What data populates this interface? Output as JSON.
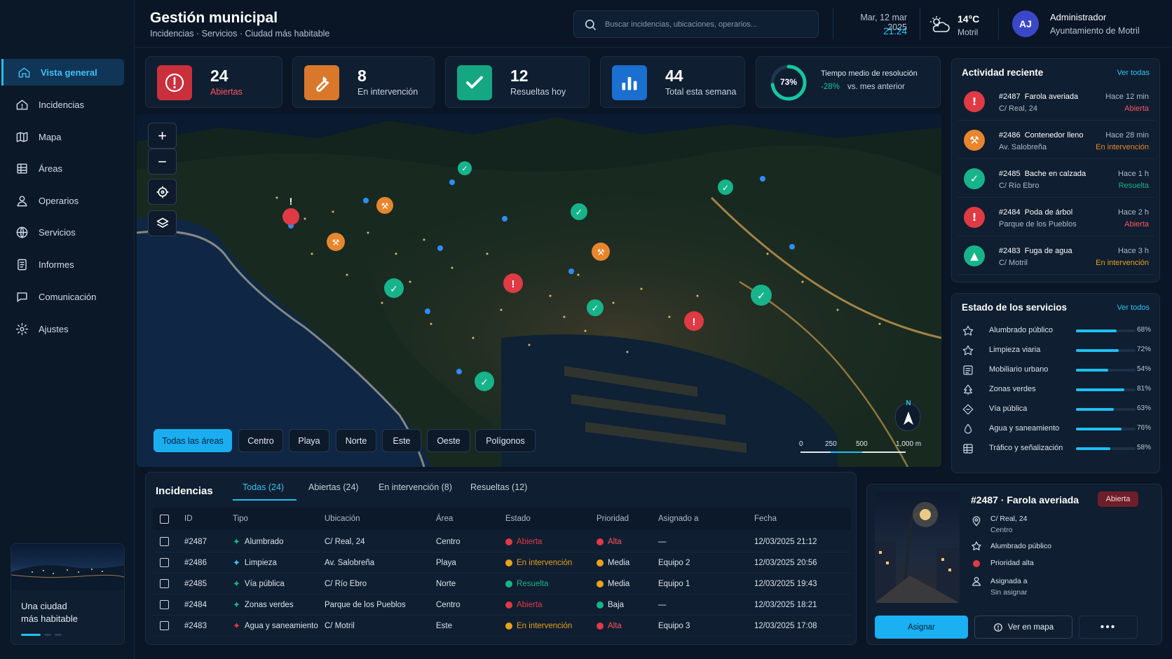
{
  "app": {
    "title": "Gestión municipal",
    "subtitle": "Incidencias · Servicios · Ciudad más habitable"
  },
  "search": {
    "placeholder": "Buscar incidencias, ubicaciones, operarios..."
  },
  "header": {
    "date": "Mar, 12 mar 2025",
    "time": "21:24",
    "temperature": "14°C",
    "location": "Motril"
  },
  "user": {
    "initials": "AJ",
    "name": "Administrador",
    "org": "Ayuntamiento de Motril"
  },
  "sidebar": {
    "items": [
      {
        "label": "Vista general",
        "icon": "home-icon",
        "active": true
      },
      {
        "label": "Incidencias",
        "icon": "alert-home-icon"
      },
      {
        "label": "Mapa",
        "icon": "map-icon"
      },
      {
        "label": "Áreas",
        "icon": "grid-icon"
      },
      {
        "label": "Operarios",
        "icon": "user-icon"
      },
      {
        "label": "Servicios",
        "icon": "globe-icon"
      },
      {
        "label": "Informes",
        "icon": "report-icon"
      },
      {
        "label": "Comunicación",
        "icon": "message-icon"
      },
      {
        "label": "Ajustes",
        "icon": "gear-icon"
      }
    ],
    "promo": {
      "line1": "Una ciudad",
      "line2": "más habitable"
    }
  },
  "stats": [
    {
      "value": "24",
      "label": "Abiertas",
      "color": "#e03a45",
      "icon": "alert-icon"
    },
    {
      "value": "8",
      "label": "En intervención",
      "color": "#e8862e",
      "icon": "wrench-icon"
    },
    {
      "value": "12",
      "label": "Resueltas hoy",
      "color": "#17b38a",
      "icon": "check-icon"
    },
    {
      "value": "44",
      "label": "Total esta semana",
      "color": "#1f8be8",
      "icon": "bar-chart-icon"
    }
  ],
  "resolution": {
    "percent": 73,
    "percent_label": "73%",
    "label": "Tiempo medio de resolución",
    "delta": "-28%",
    "delta_suffix": "vs. mes anterior"
  },
  "map": {
    "filters": [
      "Todas las áreas",
      "Centro",
      "Playa",
      "Norte",
      "Este",
      "Oeste",
      "Polígonos"
    ],
    "active_filter": "Todas las áreas",
    "compass": "N",
    "scale": [
      "0",
      "250",
      "500",
      "1,000 m"
    ]
  },
  "incidents": {
    "title": "Incidencias",
    "tabs": [
      "Todas (24)",
      "Abiertas (24)",
      "En intervención (8)",
      "Resueltas (12)"
    ],
    "columns": [
      "ID",
      "Tipo",
      "Ubicación",
      "Área",
      "Estado",
      "Prioridad",
      "Asignado a",
      "Fecha"
    ],
    "rows": [
      {
        "id": "#2487",
        "type": "Alumbrado",
        "type_color": "#17b38a",
        "location": "C/ Real, 24",
        "area": "Centro",
        "status": "Abierta",
        "status_color": "#e03a45",
        "priority": "Alta",
        "priority_color": "#e03a45",
        "assigned": "—",
        "date": "12/03/2025 21:12"
      },
      {
        "id": "#2486",
        "type": "Limpieza",
        "type_color": "#3ec3f5",
        "location": "Av. Salobreña",
        "area": "Playa",
        "status": "En intervención",
        "status_color": "#e8a21e",
        "priority": "Media",
        "priority_color": "#e8a21e",
        "assigned": "Equipo 2",
        "date": "12/03/2025 20:56"
      },
      {
        "id": "#2485",
        "type": "Vía pública",
        "type_color": "#17b38a",
        "location": "C/ Río Ebro",
        "area": "Norte",
        "status": "Resuelta",
        "status_color": "#17b38a",
        "priority": "Media",
        "priority_color": "#e8a21e",
        "assigned": "Equipo 1",
        "date": "12/03/2025 19:43"
      },
      {
        "id": "#2484",
        "type": "Zonas verdes",
        "type_color": "#17b38a",
        "location": "Parque de los Pueblos",
        "area": "Centro",
        "status": "Abierta",
        "status_color": "#e03a45",
        "priority": "Baja",
        "priority_color": "#17b38a",
        "assigned": "—",
        "date": "12/03/2025 18:21"
      },
      {
        "id": "#2483",
        "type": "Agua y saneamiento",
        "type_color": "#e03a45",
        "location": "C/ Motril",
        "area": "Este",
        "status": "En intervención",
        "status_color": "#e8a21e",
        "priority": "Alta",
        "priority_color": "#e03a45",
        "assigned": "Equipo 3",
        "date": "12/03/2025 17:08"
      }
    ]
  },
  "detail": {
    "title": "#2487 · Farola averiada",
    "badge": "Abierta",
    "address": "C/ Real, 24",
    "area": "Centro",
    "service": "Alumbrado público",
    "priority": "Prioridad alta",
    "assigned_label": "Asignada a",
    "assigned_value": "Sin asignar",
    "assign_button": "Asignar",
    "map_button": "Ver en mapa"
  },
  "activity": {
    "title": "Actividad reciente",
    "link": "Ver todas",
    "items": [
      {
        "id": "#2487",
        "title": "Farola averiada",
        "location": "C/ Real, 24",
        "time": "Hace 12 min",
        "status": "Abierta",
        "color": "#e03a45",
        "icon": "alert-icon"
      },
      {
        "id": "#2486",
        "title": "Contenedor lleno",
        "location": "Av. Salobreña",
        "time": "Hace 28 min",
        "status": "En intervención",
        "color": "#e8862e",
        "icon": "wrench-icon"
      },
      {
        "id": "#2485",
        "title": "Bache en calzada",
        "location": "C/ Río Ebro",
        "time": "Hace 1 h",
        "status": "Resuelta",
        "color": "#17b38a",
        "icon": "check-icon"
      },
      {
        "id": "#2484",
        "title": "Poda de árbol",
        "location": "Parque de los Pueblos",
        "time": "Hace 2 h",
        "status": "Abierta",
        "color": "#e03a45",
        "icon": "alert-icon"
      },
      {
        "id": "#2483",
        "title": "Fuga de agua",
        "location": "C/ Motril",
        "time": "Hace 3 h",
        "status": "En intervención",
        "color": "#17b38a",
        "status_color": "#e8a21e",
        "icon": "drop-icon"
      }
    ]
  },
  "services": {
    "title": "Estado de los servicios",
    "link": "Ver todos",
    "items": [
      {
        "name": "Alumbrado público",
        "percent": 68,
        "percent_label": "68%"
      },
      {
        "name": "Limpieza viaria",
        "percent": 72,
        "percent_label": "72%"
      },
      {
        "name": "Mobiliario urbano",
        "percent": 54,
        "percent_label": "54%"
      },
      {
        "name": "Zonas verdes",
        "percent": 81,
        "percent_label": "81%"
      },
      {
        "name": "Vía pública",
        "percent": 63,
        "percent_label": "63%"
      },
      {
        "name": "Agua y saneamiento",
        "percent": 76,
        "percent_label": "76%"
      },
      {
        "name": "Tráfico y señalización",
        "percent": 58,
        "percent_label": "58%"
      }
    ]
  }
}
